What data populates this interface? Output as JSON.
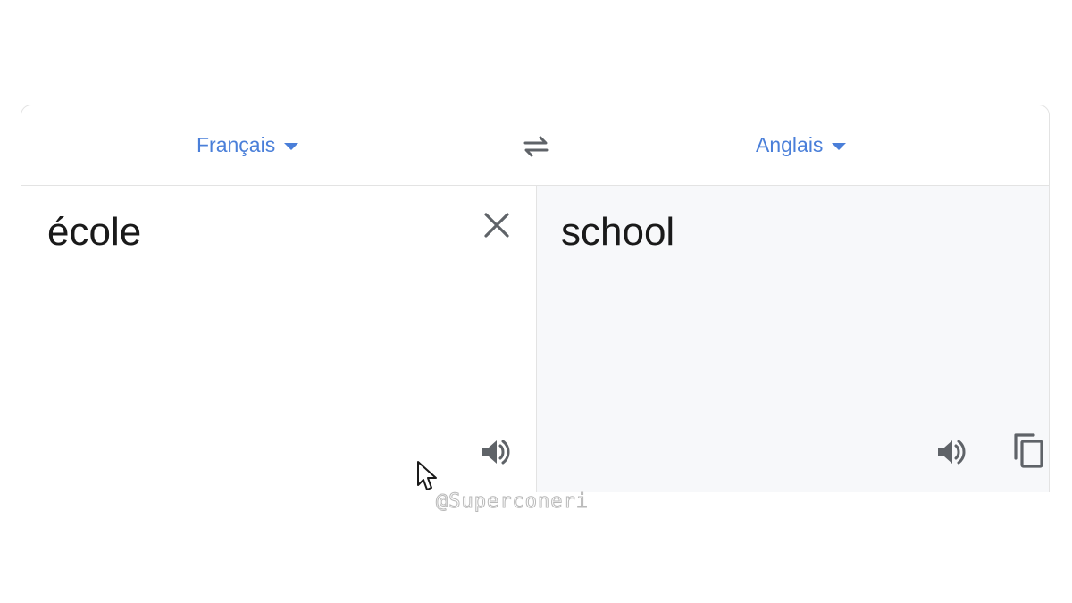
{
  "header": {
    "source_language": "Français",
    "target_language": "Anglais",
    "swap_icon": "swap-arrows-icon",
    "dropdown_icon": "caret-down-icon"
  },
  "source_pane": {
    "text": "école",
    "clear_icon": "close-icon",
    "speak_icon": "speaker-icon"
  },
  "target_pane": {
    "text": "school",
    "speak_icon": "speaker-icon",
    "copy_icon": "copy-icon"
  },
  "watermark": {
    "text": "@Superconeri"
  },
  "colors": {
    "accent": "#4a7fd9",
    "border": "#e3e3e3",
    "target_background": "#f7f8fa",
    "icon": "#5f6368",
    "text": "#1a1a1a"
  }
}
